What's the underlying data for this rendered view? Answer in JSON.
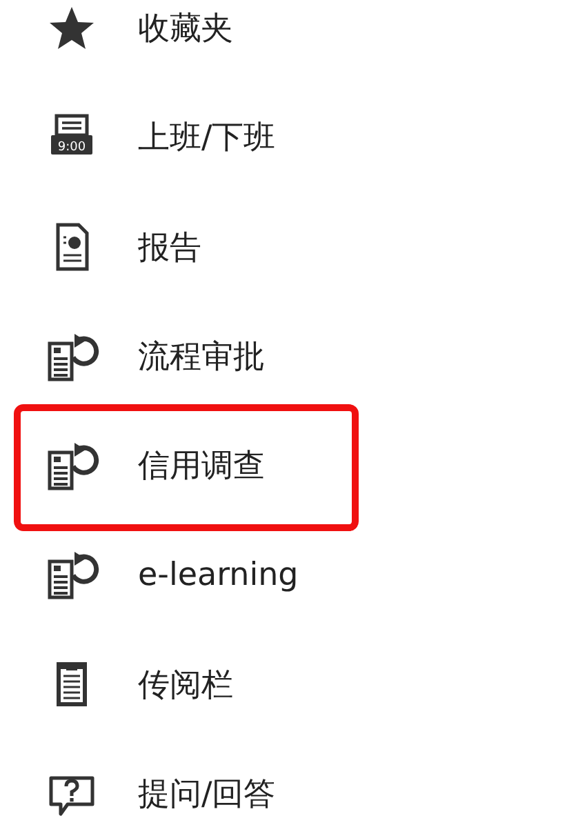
{
  "menu": {
    "items": [
      {
        "kind": "star",
        "label": "收藏夹",
        "highlighted": false
      },
      {
        "kind": "clock",
        "label": "上班/下班",
        "icon_text": "9:00",
        "highlighted": false
      },
      {
        "kind": "report",
        "label": "报告",
        "highlighted": false
      },
      {
        "kind": "process",
        "label": "流程审批",
        "highlighted": false
      },
      {
        "kind": "process",
        "label": "信用调查",
        "highlighted": true
      },
      {
        "kind": "process",
        "label": "e-learning",
        "highlighted": false
      },
      {
        "kind": "board",
        "label": "传阅栏",
        "highlighted": false
      },
      {
        "kind": "question",
        "label": "提问/回答",
        "highlighted": false
      }
    ]
  }
}
